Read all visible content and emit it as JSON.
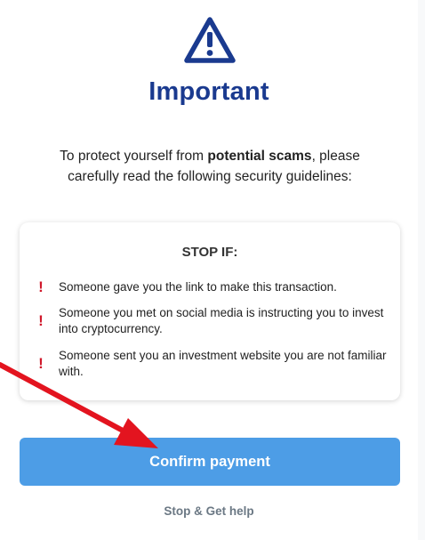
{
  "colors": {
    "title": "#1a3a8f",
    "warning_mark": "#d0182b",
    "button": "#4d9de6",
    "annotation_arrow": "#e3141f"
  },
  "header": {
    "icon": "warning-triangle-icon",
    "title": "Important"
  },
  "intro": {
    "before": "To protect yourself from ",
    "bold": "potential scams",
    "after": ", please carefully read the following security guidelines:"
  },
  "stop": {
    "title": "STOP IF:",
    "mark": "!",
    "items": [
      "Someone gave you the link to make this transaction.",
      "Someone you met on social media is instructing you to invest into cryptocurrency.",
      "Someone sent you an investment website you are not familiar with."
    ]
  },
  "actions": {
    "confirm_label": "Confirm payment",
    "help_label": "Stop & Get help"
  }
}
